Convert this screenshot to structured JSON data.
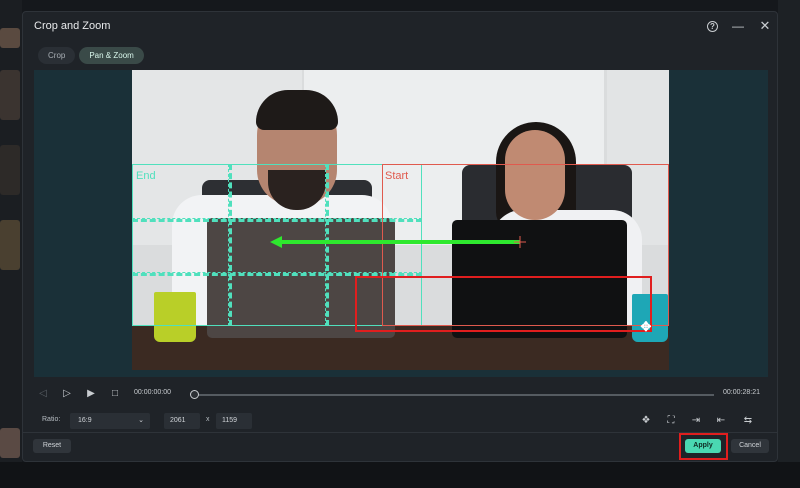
{
  "dialog": {
    "title": "Crop and Zoom",
    "icons": {
      "help": "help-circle-icon",
      "minimize": "minimize-icon",
      "close": "close-icon"
    }
  },
  "tabs": [
    {
      "label": "Crop",
      "active": false
    },
    {
      "label": "Pan & Zoom",
      "active": true
    }
  ],
  "preview": {
    "end_label": "End",
    "start_label": "Start",
    "colors": {
      "end_frame": "#50e0bd",
      "start_frame": "#e05a4e",
      "arrow": "#2ee82e",
      "highlight": "#e01e1e"
    }
  },
  "playback": {
    "current_time": "00:00:00:00",
    "total_time": "00:00:28:21",
    "progress": 0
  },
  "ratio": {
    "label": "Ratio:",
    "value": "16:9",
    "width": "2061",
    "separator": "x",
    "height": "1159"
  },
  "buttons": {
    "reset": "Reset",
    "apply": "Apply",
    "cancel": "Cancel"
  },
  "accent_color": "#4ad8b2"
}
